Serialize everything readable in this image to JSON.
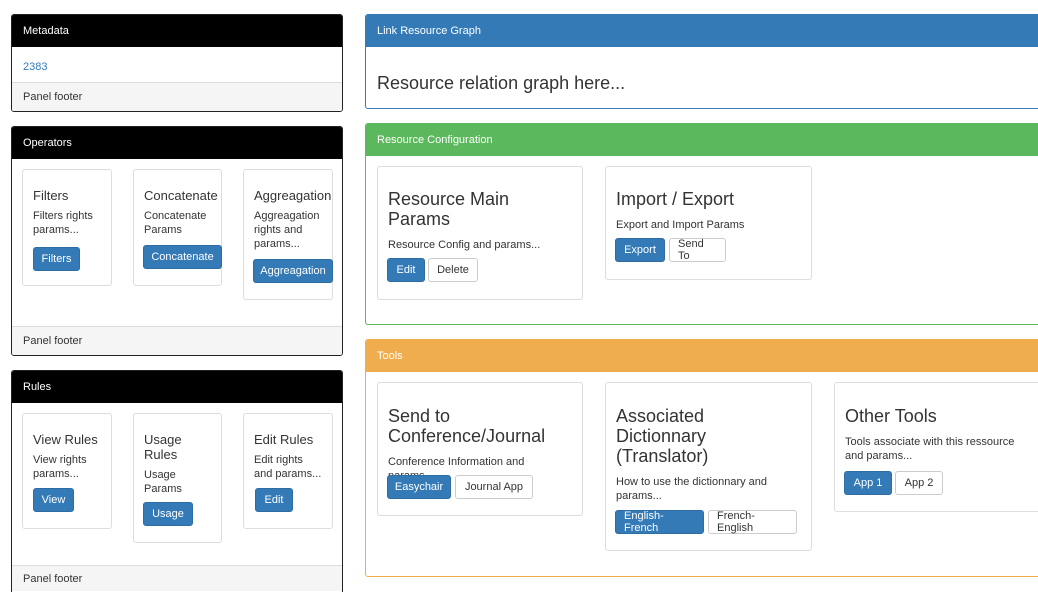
{
  "metadata": {
    "title": "Metadata",
    "value": "2383",
    "footer": "Panel footer"
  },
  "operators": {
    "title": "Operators",
    "footer": "Panel footer",
    "cards": [
      {
        "title": "Filters",
        "desc": "Filters rights params...",
        "button": "Filters"
      },
      {
        "title": "Concatenate",
        "desc": "Concatenate Params",
        "button": "Concatenate"
      },
      {
        "title": "Aggreagation",
        "desc": "Aggreagation rights and params...",
        "button": "Aggreagation"
      }
    ]
  },
  "rules": {
    "title": "Rules",
    "footer": "Panel footer",
    "cards": [
      {
        "title": "View Rules",
        "desc": "View rights params...",
        "button": "View"
      },
      {
        "title": "Usage Rules",
        "desc": "Usage Params",
        "button": "Usage"
      },
      {
        "title": "Edit Rules",
        "desc": "Edit rights and params...",
        "button": "Edit"
      }
    ]
  },
  "link_graph": {
    "title": "Link Resource Graph",
    "body": "Resource relation graph here..."
  },
  "resource_config": {
    "title": "Resource Configuration",
    "cards": [
      {
        "title": "Resource Main Params",
        "desc": "Resource Config and params...",
        "primary": "Edit",
        "secondary": "Delete"
      },
      {
        "title": "Import / Export",
        "desc": "Export and Import Params",
        "primary": "Export",
        "secondary": "Send To"
      }
    ]
  },
  "tools": {
    "title": "Tools",
    "cards": [
      {
        "title": "Send to Conference/Journal",
        "desc": "Conference Information and params...",
        "primary": "Easychair",
        "secondary": "Journal App"
      },
      {
        "title": "Associated Dictionnary (Translator)",
        "desc": "How to use the dictionnary and params...",
        "primary": "English-French",
        "secondary": "French-English"
      },
      {
        "title": "Other Tools",
        "desc": "Tools associate with this ressource and params...",
        "primary": "App 1",
        "secondary": "App 2"
      }
    ]
  }
}
